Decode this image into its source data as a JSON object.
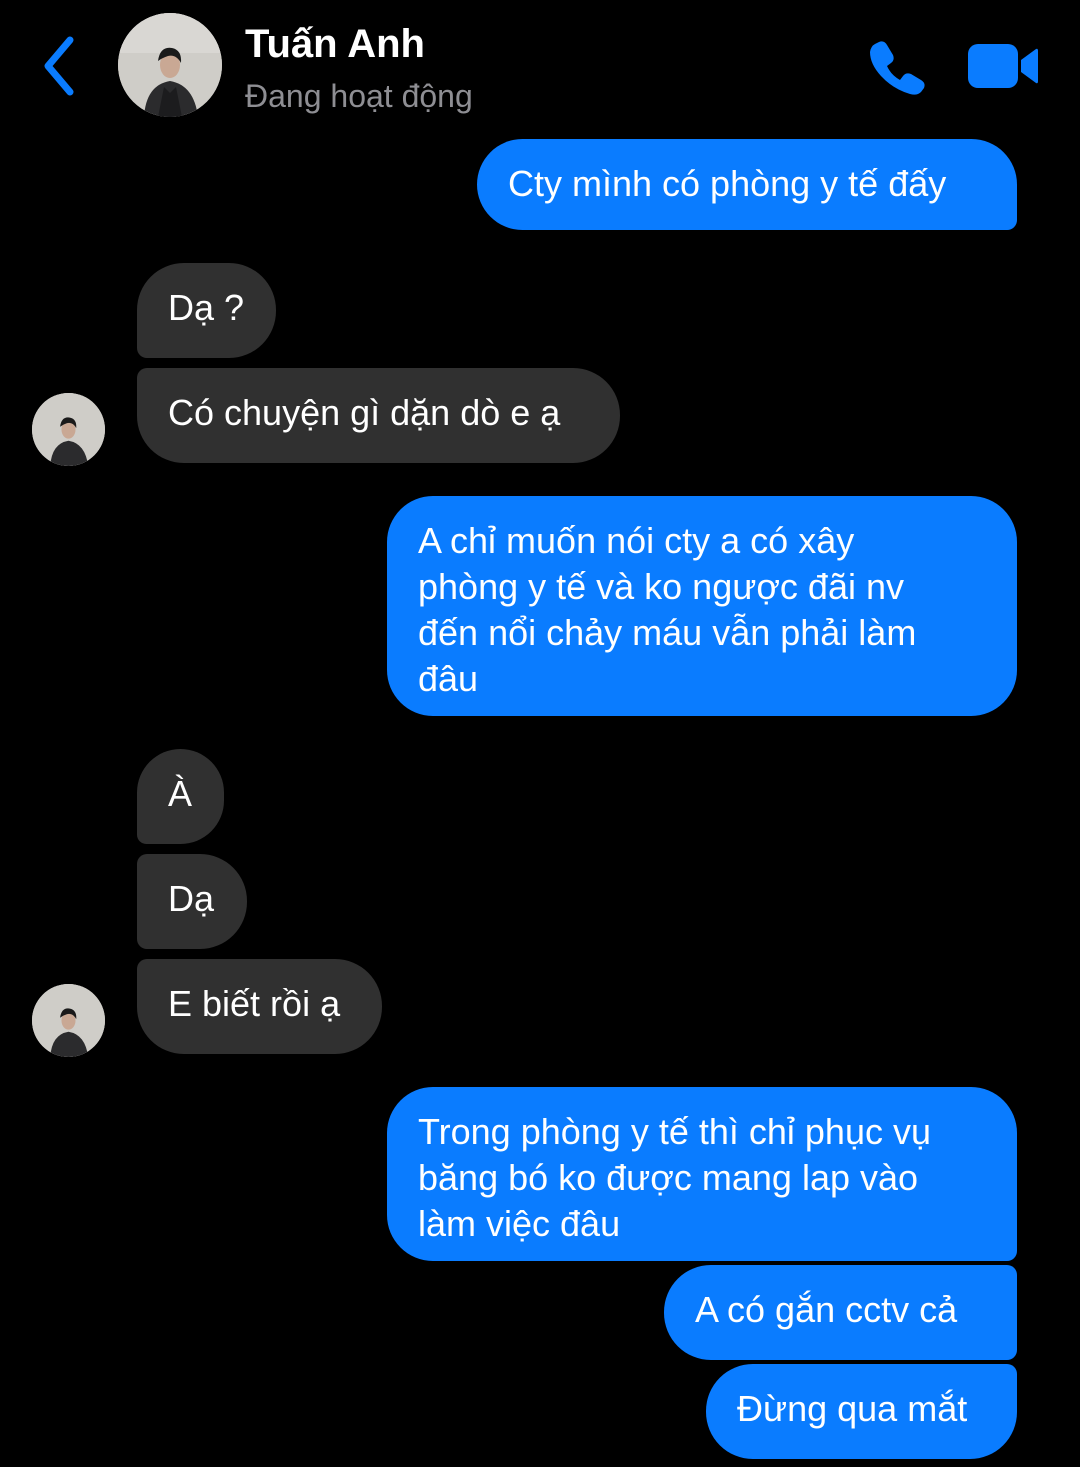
{
  "header": {
    "name": "Tuấn Anh",
    "status": "Đang hoạt động",
    "icons": {
      "back": "chevron-left-icon",
      "call": "phone-icon",
      "video": "video-camera-icon"
    },
    "accent_color": "#0a7cff"
  },
  "messages": [
    {
      "side": "out",
      "text": "Cty mình có phòng y tế đấy"
    },
    {
      "side": "in",
      "text": "Dạ ?"
    },
    {
      "side": "in",
      "text": "Có chuyện gì dặn dò e ạ"
    },
    {
      "side": "out",
      "text": "A chỉ muốn nói cty a có xây\nphòng y tế và ko ngược đãi nv\nđến nổi chảy máu vẫn phải làm\nđâu"
    },
    {
      "side": "in",
      "text": "À"
    },
    {
      "side": "in",
      "text": "Dạ"
    },
    {
      "side": "in",
      "text": "E biết rồi ạ"
    },
    {
      "side": "out",
      "text": "Trong phòng y tế thì chỉ phục vụ\nbăng bó ko được mang lap vào\nlàm việc đâu"
    },
    {
      "side": "out",
      "text": "A có gắn cctv cả"
    },
    {
      "side": "out",
      "text": "Đừng qua mắt"
    }
  ],
  "colors": {
    "background": "#000000",
    "outgoing_bubble": "#0a7cff",
    "incoming_bubble": "#303030",
    "status_text": "#8e8e93"
  }
}
